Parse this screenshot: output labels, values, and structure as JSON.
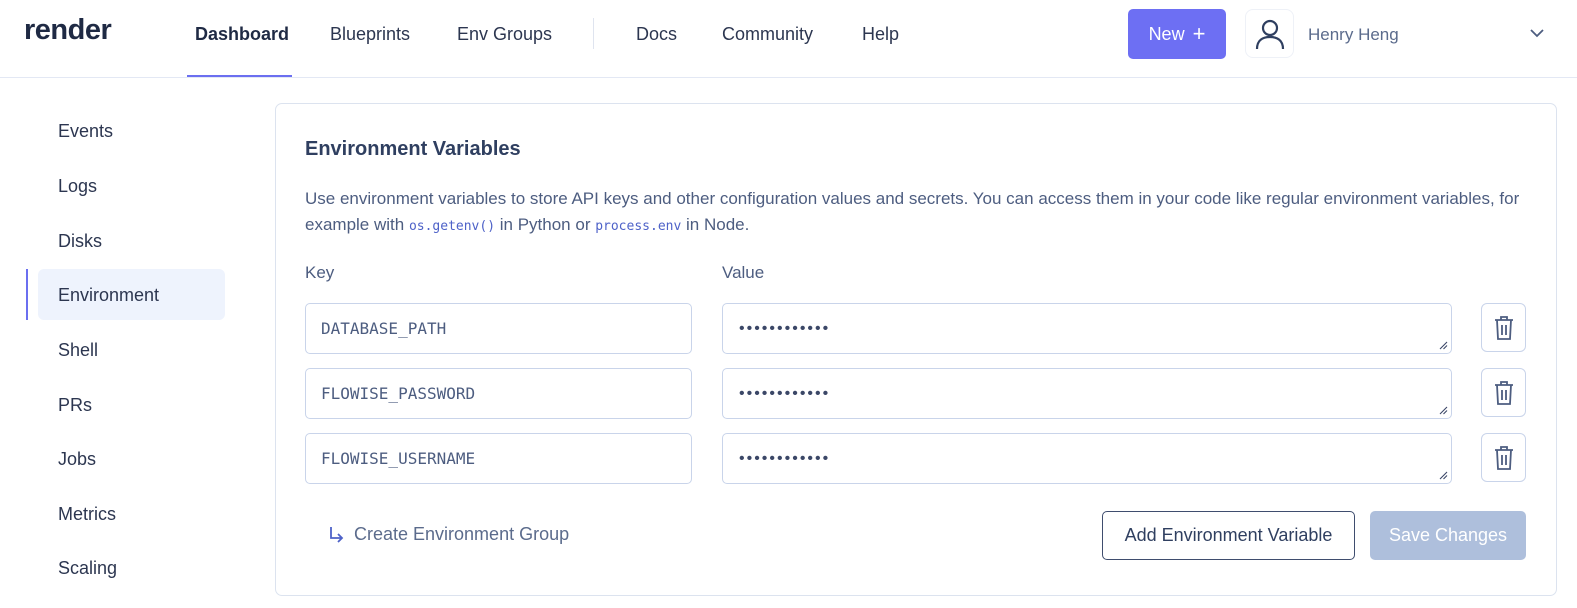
{
  "header": {
    "logo": "render",
    "nav": [
      {
        "label": "Dashboard",
        "active": true
      },
      {
        "label": "Blueprints"
      },
      {
        "label": "Env Groups"
      },
      {
        "label": "Docs"
      },
      {
        "label": "Community"
      },
      {
        "label": "Help"
      }
    ],
    "new_button": {
      "label": "New",
      "icon": "plus-icon"
    },
    "user": {
      "name": "Henry Heng",
      "avatar_icon": "user-icon",
      "menu_icon": "chevron-down-icon"
    },
    "accent_color": "#6d6ff3"
  },
  "sidebar": {
    "items": [
      {
        "label": "Events"
      },
      {
        "label": "Logs"
      },
      {
        "label": "Disks"
      },
      {
        "label": "Environment",
        "active": true
      },
      {
        "label": "Shell"
      },
      {
        "label": "PRs"
      },
      {
        "label": "Jobs"
      },
      {
        "label": "Metrics"
      },
      {
        "label": "Scaling"
      }
    ]
  },
  "main": {
    "title": "Environment Variables",
    "description": {
      "part1": "Use environment variables to store API keys and other configuration values and secrets. You can access them in your code like regular environment variables, for example with ",
      "code1": "os.getenv()",
      "part2": " in Python or ",
      "code2": "process.env",
      "part3": " in Node."
    },
    "key_label": "Key",
    "value_label": "Value",
    "variables": [
      {
        "key": "DATABASE_PATH",
        "value": "••••••••••••"
      },
      {
        "key": "FLOWISE_PASSWORD",
        "value": "••••••••••••"
      },
      {
        "key": "FLOWISE_USERNAME",
        "value": "••••••••••••"
      }
    ],
    "create_group_label": "Create Environment Group",
    "add_button_label": "Add Environment Variable",
    "save_button_label": "Save Changes"
  }
}
